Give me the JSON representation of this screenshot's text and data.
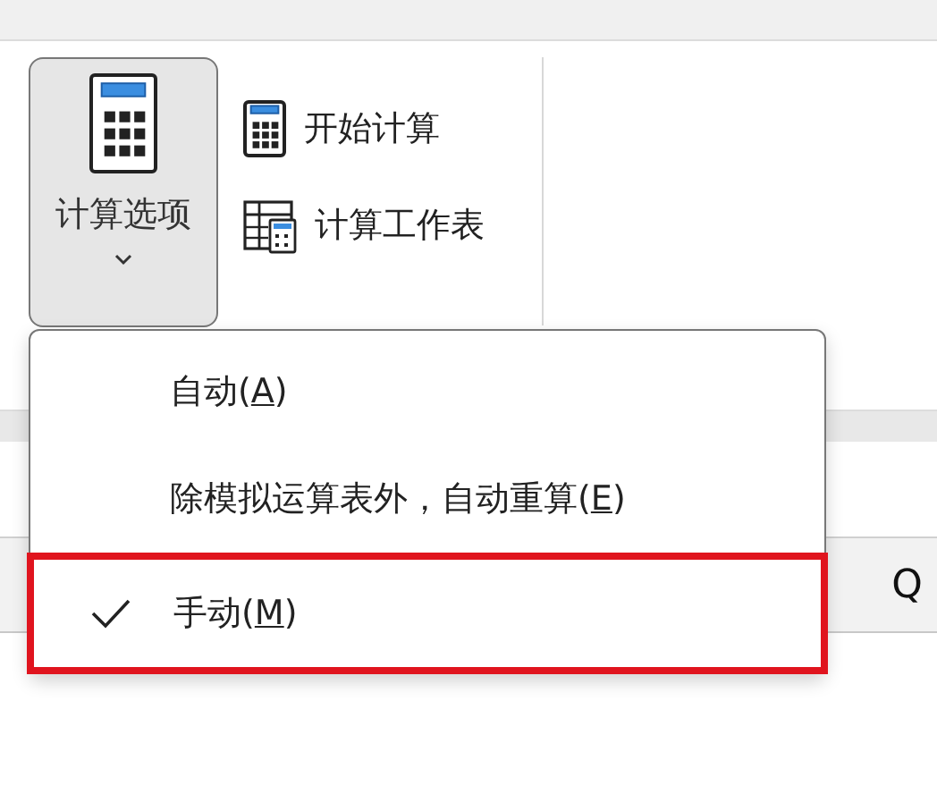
{
  "ribbon": {
    "options_button": {
      "label": "计算选项",
      "pressed": true
    },
    "commands": [
      {
        "kind": "calculate",
        "label": "开始计算"
      },
      {
        "kind": "sheet",
        "label": "计算工作表"
      }
    ]
  },
  "sheet": {
    "column_header": "Q"
  },
  "menu": {
    "items": [
      {
        "before": "自动(",
        "key": "A",
        "after": ")",
        "checked": false,
        "highlighted": false
      },
      {
        "before": "除模拟运算表外，自动重算(",
        "key": "E",
        "after": ")",
        "checked": false,
        "highlighted": false
      },
      {
        "before": "手动(",
        "key": "M",
        "after": ")",
        "checked": true,
        "highlighted": true
      }
    ]
  }
}
